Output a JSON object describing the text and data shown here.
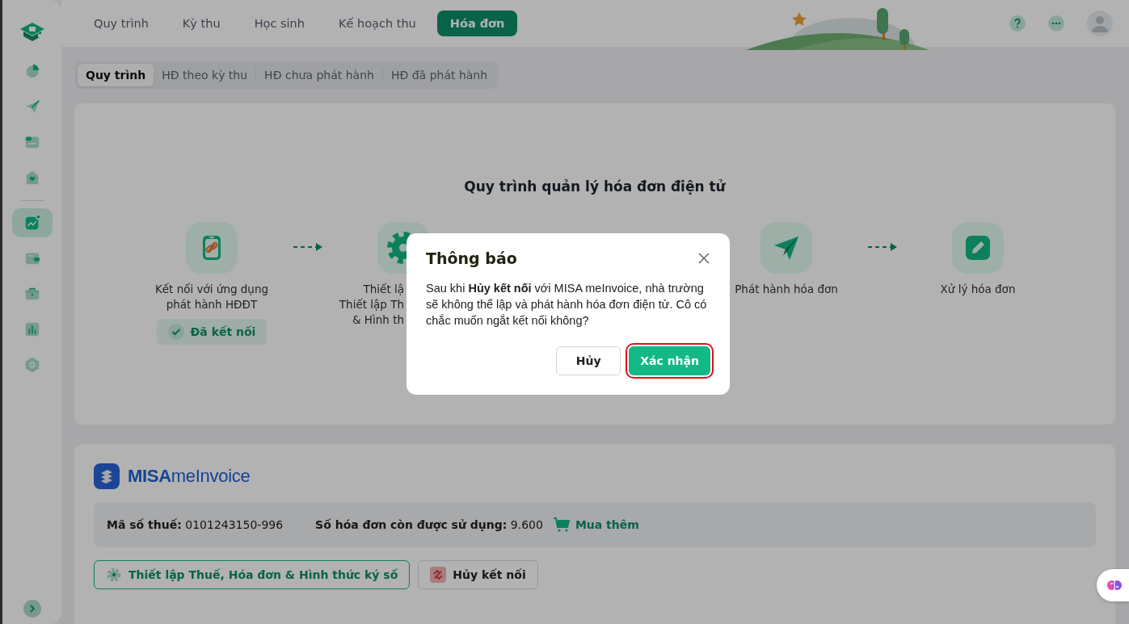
{
  "sidebar": {
    "items": [
      {
        "kind": "pie",
        "selected": false
      },
      {
        "kind": "send",
        "selected": false
      },
      {
        "kind": "folder",
        "selected": false
      },
      {
        "kind": "heart",
        "selected": false
      },
      {
        "kind": "trend",
        "selected": true
      },
      {
        "kind": "wallet",
        "selected": false
      },
      {
        "kind": "briefcase",
        "selected": false
      },
      {
        "kind": "bars",
        "selected": false
      },
      {
        "kind": "hexagon",
        "selected": false
      }
    ]
  },
  "top_nav": {
    "tabs": [
      {
        "label": "Quy trình",
        "selected": false
      },
      {
        "label": "Kỳ thu",
        "selected": false
      },
      {
        "label": "Học sinh",
        "selected": false
      },
      {
        "label": "Kế hoạch thu",
        "selected": false
      },
      {
        "label": "Hóa đơn",
        "selected": true
      }
    ]
  },
  "sub_tabs": [
    {
      "label": "Quy trình",
      "selected": true
    },
    {
      "label": "HĐ theo kỳ thu",
      "selected": false
    },
    {
      "label": "HĐ chưa phát hành",
      "selected": false
    },
    {
      "label": "HĐ đã phát hành",
      "selected": false
    }
  ],
  "process": {
    "title": "Quy trình quản lý hóa đơn điện tử",
    "steps": [
      {
        "kind": "link",
        "lines": [
          "Kết nối với ứng dụng",
          "phát hành HĐĐT"
        ],
        "status": "Đã kết nối"
      },
      {
        "kind": "gear",
        "lines": [
          "Thiết lậ",
          "Thiết lập Th",
          "& Hình th"
        ]
      },
      {
        "kind": "send",
        "lines": [
          "Phát hành hóa đơn"
        ]
      },
      {
        "kind": "edit",
        "lines": [
          "Xử lý hóa đơn"
        ]
      }
    ]
  },
  "provider": {
    "wordmark": [
      "MISA",
      "meInvoice"
    ],
    "tax_code": "**Mã số thuế:** 0101243150-996",
    "remaining": "**Số hóa đơn còn được sử dụng:** 9.600",
    "buy_more": "Mua thêm",
    "buttons": [
      {
        "kind": "settings",
        "label": "Thiết lập Thuế, Hóa đơn & Hình thức ký số"
      },
      {
        "kind": "disconnect",
        "label": "Hủy kết nối"
      }
    ]
  },
  "dialog": {
    "title": "Thông báo",
    "message": "Sau khi **Hủy kết nối** với MISA meInvoice, nhà trường sẽ không thể lập và phát hành hóa đơn điện tử. Cô có chắc muốn ngắt kết nối không?",
    "buttons": [
      {
        "kind": "secondary",
        "label": "Hủy",
        "focused": false
      },
      {
        "kind": "primary",
        "label": "Xác nhận",
        "focused": true
      }
    ]
  }
}
